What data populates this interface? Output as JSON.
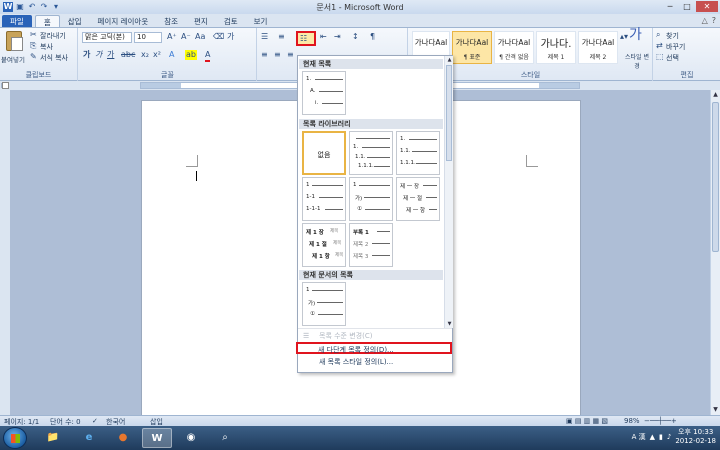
{
  "window": {
    "title": "문서1 - Microsoft Word",
    "colors": {
      "file_tab": "#2a63b8",
      "highlight": "#e0141e",
      "selected": "#e9b444"
    }
  },
  "ribbon_tabs": [
    "파일",
    "홈",
    "삽입",
    "페이지 레이아웃",
    "참조",
    "편지",
    "검토",
    "보기"
  ],
  "ribbon": {
    "clipboard": {
      "paste": "붙여넣기",
      "cut": "잘라내기",
      "copy": "복사",
      "format_painter": "서식 복사",
      "label": "클립보드"
    },
    "font": {
      "font_name": "맑은 고딕(본)",
      "font_size": "10",
      "bold": "가",
      "italic": "가",
      "underline": "가",
      "label": "글꼴"
    },
    "paragraph": {
      "label": "단락"
    },
    "styles": {
      "items": [
        {
          "preview": "가나다Aal",
          "name": "¶ 표준"
        },
        {
          "preview": "가나다Aal",
          "name": "¶ 간격 없음"
        },
        {
          "preview": "가나다.",
          "name": "제목 1"
        },
        {
          "preview": "가나다Aal",
          "name": "제목 2"
        }
      ],
      "first_preview": "가나다Aal",
      "change_style": "스타일 변경",
      "label": "스타일"
    },
    "editing": {
      "find": "찾기",
      "replace": "바꾸기",
      "select": "선택",
      "label": "편집"
    }
  },
  "dropdown": {
    "section_current": "현재 목록",
    "section_library": "목록 라이브러리",
    "section_document": "현재 문서의 목록",
    "none_label": "없음",
    "library_texts": {
      "a1": "1.",
      "a2": "1.1.",
      "a3": "1.1.1.",
      "b1": "1.",
      "b2": "1.1.",
      "b3": "1.1.1.",
      "c1": "1",
      "c2": "1-1",
      "c3": "1-1-1",
      "d1": "1",
      "d2": "가)",
      "d3": "①",
      "e1": "제 一 장",
      "e2": "제 一 절",
      "e3": "제 一 항",
      "f1": "제 1 장",
      "f2": "제 1 절",
      "f3": "제 1 항",
      "f_suffix": "제목",
      "g1": "부록 1",
      "g2": "제목 2",
      "g3": "제목 3"
    },
    "current_list_texts": {
      "l1": "1.",
      "l2": "A.",
      "l3": "i."
    },
    "document_list_texts": {
      "l1": "1",
      "l2": "가)",
      "l3": "①"
    },
    "menu_items": [
      {
        "label": "목록 수준 변경(C)",
        "disabled": true
      },
      {
        "label": "새 다단계 목록 정의(D)...",
        "highlighted": true
      },
      {
        "label": "새 목록 스타일 정의(L)..."
      }
    ]
  },
  "statusbar": {
    "page": "페이지: 1/1",
    "words": "단어 수: 0",
    "language": "한국어",
    "mode": "삽입",
    "zoom": "98%"
  },
  "taskbar": {
    "ime": "A 漢",
    "time": "오후 10:33",
    "date": "2012-02-18"
  }
}
